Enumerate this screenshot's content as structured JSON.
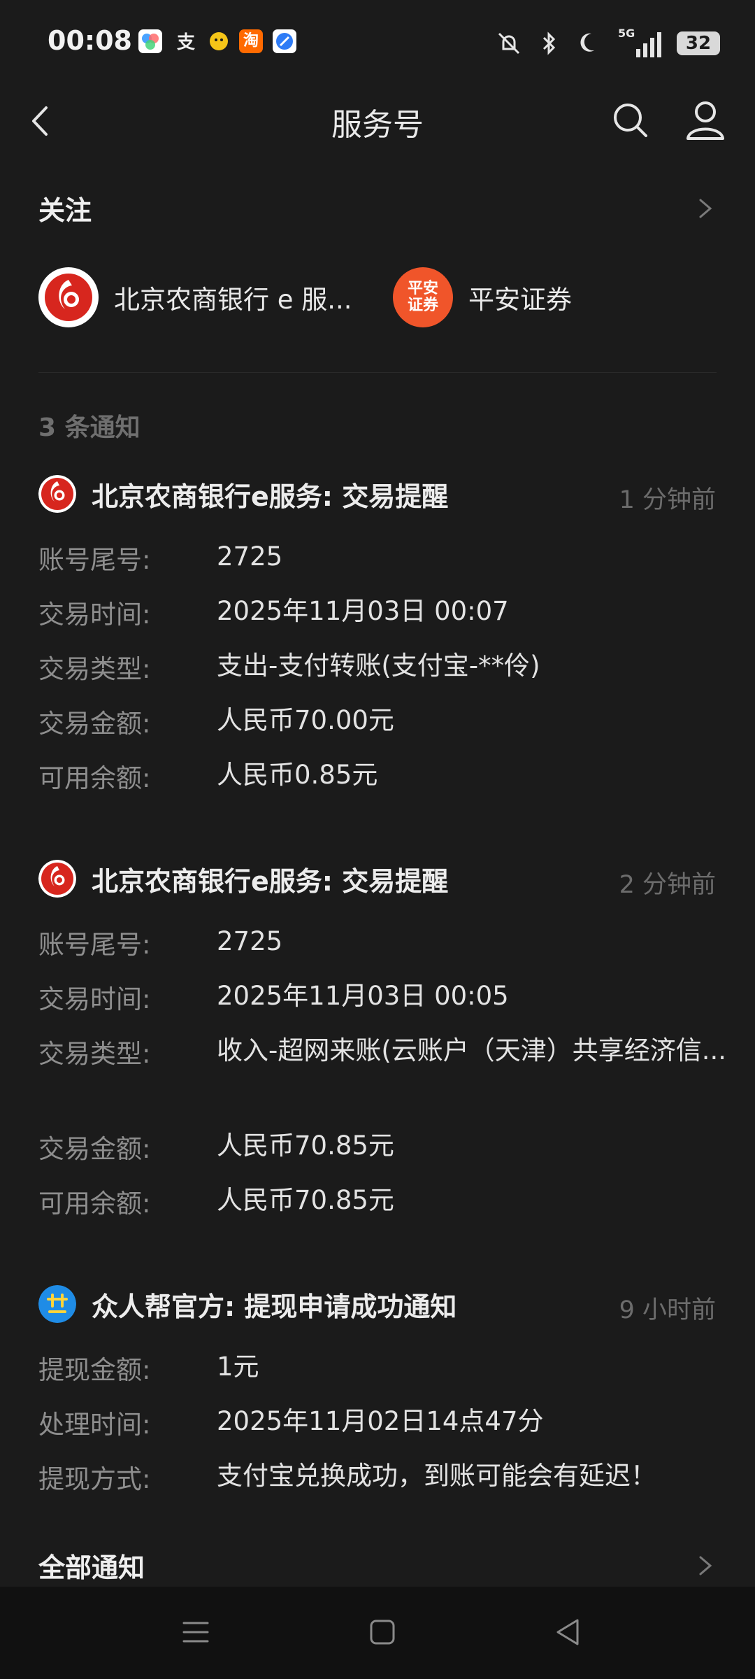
{
  "status_bar": {
    "time": "00:08",
    "app_icons": [
      "photos-icon",
      "alipay-icon",
      "chat-icon",
      "taobao-icon",
      "browser-icon"
    ],
    "taobao_label": "淘",
    "network": "5G",
    "battery": "32"
  },
  "header": {
    "title": "服务号"
  },
  "follow": {
    "title": "关注",
    "accounts": [
      {
        "name": "北京农商银行 e 服...",
        "icon": "bank-logo-icon"
      },
      {
        "name": "平安证券",
        "icon": "pingan-logo-icon",
        "logo_text": "平安证券"
      }
    ]
  },
  "notifications": {
    "count_label": "3 条通知",
    "items": [
      {
        "title": "北京农商银行e服务: 交易提醒",
        "time": "1 分钟前",
        "rows": [
          {
            "k": "账号尾号:",
            "v": "2725"
          },
          {
            "k": "交易时间:",
            "v": "2025年11月03日 00:07"
          },
          {
            "k": "交易类型:",
            "v": "支出-支付转账(支付宝-**伶)"
          },
          {
            "k": "交易金额:",
            "v": "人民币70.00元"
          },
          {
            "k": "可用余额:",
            "v": "人民币0.85元"
          }
        ]
      },
      {
        "title": "北京农商银行e服务: 交易提醒",
        "time": "2 分钟前",
        "rows": [
          {
            "k": "账号尾号:",
            "v": "2725"
          },
          {
            "k": "交易时间:",
            "v": "2025年11月03日 00:05"
          },
          {
            "k": "交易类型:",
            "v": "收入-超网来账(云账户（天津）共享经济信..."
          },
          {
            "k": "交易金额:",
            "v": "人民币70.85元"
          },
          {
            "k": "可用余额:",
            "v": "人民币70.85元"
          }
        ]
      },
      {
        "title": "众人帮官方: 提现申请成功通知",
        "time": "9 小时前",
        "rows": [
          {
            "k": "提现金额:",
            "v": "1元"
          },
          {
            "k": "处理时间:",
            "v": "2025年11月02日14点47分"
          },
          {
            "k": "提现方式:",
            "v": "支付宝兑换成功，到账可能会有延迟！"
          }
        ]
      }
    ],
    "all_label": "全部通知"
  },
  "colors": {
    "background": "#1b1b1b",
    "bank_red": "#d7261e",
    "pingan_orange": "#f0552a",
    "zrb_blue": "#1f8ce6"
  }
}
